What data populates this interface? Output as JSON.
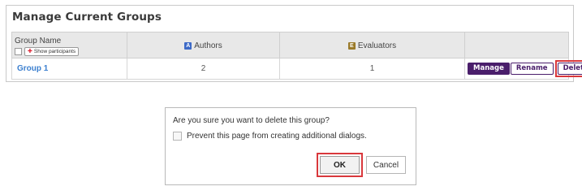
{
  "panel": {
    "title": "Manage Current Groups",
    "columns": {
      "name": "Group Name",
      "show_participants": "Show participants",
      "authors": "Authors",
      "evaluators": "Evaluators"
    },
    "rows": [
      {
        "name": "Group 1",
        "authors": "2",
        "evaluators": "1"
      }
    ],
    "actions": {
      "manage": "Manage",
      "rename": "Rename",
      "delete": "Delete"
    },
    "icons": {
      "authors_glyph": "A",
      "evaluators_glyph": "E"
    }
  },
  "dialog": {
    "message": "Are you sure you want to delete this group?",
    "checkbox_label": "Prevent this page from creating additional dialogs.",
    "ok_label": "OK",
    "cancel_label": "Cancel"
  },
  "colors": {
    "brand_purple": "#4a1e6b",
    "highlight_red": "#d9383c",
    "link_blue": "#3b7fcf"
  }
}
